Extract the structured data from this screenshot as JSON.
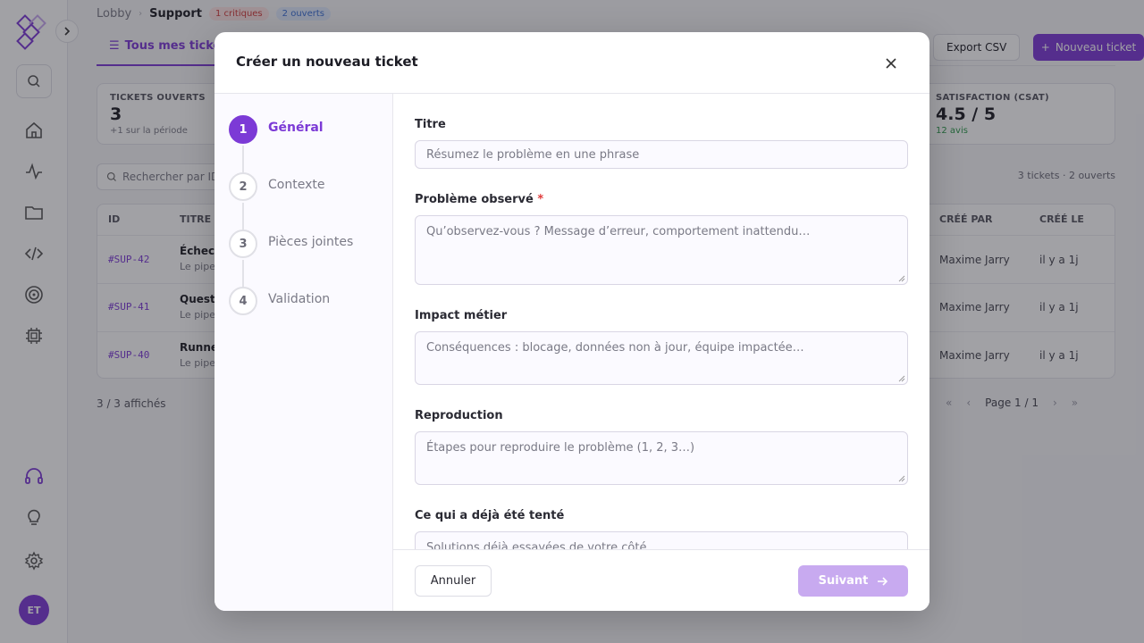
{
  "sidebar": {
    "avatar_initials": "ET",
    "accent_color": "#7c3ad6"
  },
  "page": {
    "breadcrumb": {
      "root": "Lobby",
      "current": "Support"
    },
    "badges": {
      "critical": "1 critiques",
      "open": "2 ouverts"
    },
    "tab_active": "Tous mes tickets",
    "export_label": "Export CSV",
    "new_ticket_label": "Nouveau ticket",
    "stats": [
      {
        "label": "TICKETS OUVERTS",
        "value": "3",
        "sub": "+1 sur la période"
      },
      {
        "label": "SATISFACTION (CSAT)",
        "value": "4.5 / 5",
        "sub": "12 avis"
      }
    ],
    "search_placeholder": "Rechercher par ID",
    "count_text": "3 tickets · 2 ouverts",
    "table": {
      "headers": {
        "id": "ID",
        "title": "TITRE",
        "created_by": "CRÉÉ PAR",
        "created_at": "CRÉÉ LE"
      },
      "rows": [
        {
          "id": "#SUP-42",
          "title": "Échec",
          "sub": "Le pipe",
          "created_by": "Maxime Jarry",
          "created_at": "il y a 1j"
        },
        {
          "id": "#SUP-41",
          "title": "Questio",
          "sub": "Le pipe",
          "created_by": "Maxime Jarry",
          "created_at": "il y a 1j"
        },
        {
          "id": "#SUP-40",
          "title": "Runner",
          "sub": "Le pipe",
          "created_by": "Maxime Jarry",
          "created_at": "il y a 1j"
        }
      ]
    },
    "shown_text": "3 / 3 affichés",
    "page_label": "Page 1 / 1"
  },
  "modal": {
    "title": "Créer un nouveau ticket",
    "steps": [
      {
        "num": "1",
        "label": "Général"
      },
      {
        "num": "2",
        "label": "Contexte"
      },
      {
        "num": "3",
        "label": "Pièces jointes"
      },
      {
        "num": "4",
        "label": "Validation"
      }
    ],
    "fields": {
      "titre": {
        "label": "Titre",
        "placeholder": "Résumez le problème en une phrase"
      },
      "probleme": {
        "label": "Problème observé",
        "required_mark": "*",
        "placeholder": "Qu’observez-vous ? Message d’erreur, comportement inattendu…"
      },
      "impact": {
        "label": "Impact métier",
        "placeholder": "Conséquences : blocage, données non à jour, équipe impactée…"
      },
      "reproduction": {
        "label": "Reproduction",
        "placeholder": "Étapes pour reproduire le problème (1, 2, 3…)"
      },
      "tente": {
        "label": "Ce qui a déjà été tenté",
        "placeholder": "Solutions déjà essayées de votre côté"
      }
    },
    "cancel_label": "Annuler",
    "next_label": "Suivant"
  }
}
